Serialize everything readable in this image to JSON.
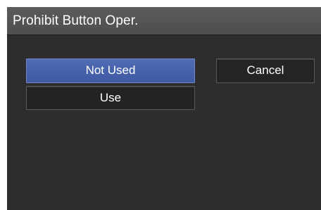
{
  "dialog": {
    "title": "Prohibit Button Oper."
  },
  "options": [
    {
      "label": "Not Used",
      "selected": true
    },
    {
      "label": "Use",
      "selected": false
    }
  ],
  "actions": {
    "cancel_label": "Cancel"
  },
  "colors": {
    "panel_bg": "#2d2d2d",
    "titlebar_bg": "#555555",
    "selected_bg": "#4763ad",
    "option_bg": "#232323",
    "text": "#ffffff"
  }
}
